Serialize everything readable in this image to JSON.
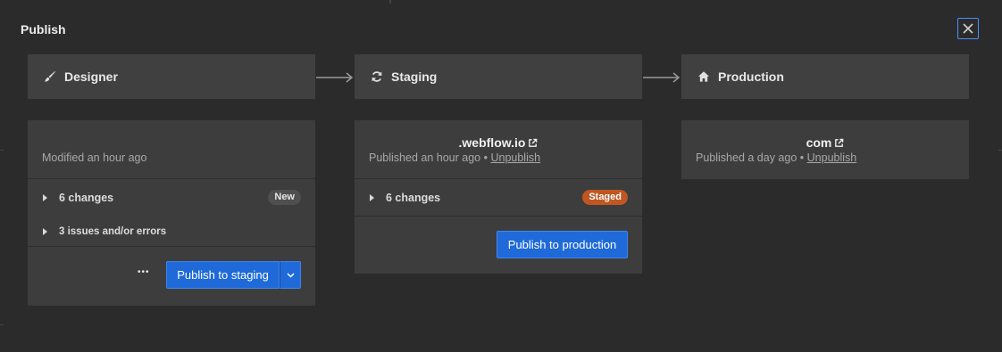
{
  "dialog": {
    "title": "Publish",
    "close_icon": "close-icon"
  },
  "stages": [
    {
      "label": "Designer",
      "icon": "brush-icon"
    },
    {
      "label": "Staging",
      "icon": "sync-icon"
    },
    {
      "label": "Production",
      "icon": "home-icon"
    }
  ],
  "designer": {
    "status": "Modified an hour ago",
    "changes_label": "6 changes",
    "changes_badge": "New",
    "issues_label": "3 issues and/or errors",
    "more_label": "•••",
    "publish_button": "Publish to staging"
  },
  "staging": {
    "domain": ".webflow.io",
    "published": "Published an hour ago",
    "separator": "•",
    "unpublish": "Unpublish",
    "changes_label": "6 changes",
    "changes_badge": "Staged",
    "publish_button": "Publish to production"
  },
  "production": {
    "domain": "com",
    "published": "Published a day ago",
    "separator": "•",
    "unpublish": "Unpublish"
  },
  "colors": {
    "background": "#2b2b2b",
    "panel": "#3d3d3d",
    "accent": "#1f6ad8",
    "staged_badge": "#c05621",
    "new_badge": "#4f4f4f"
  }
}
